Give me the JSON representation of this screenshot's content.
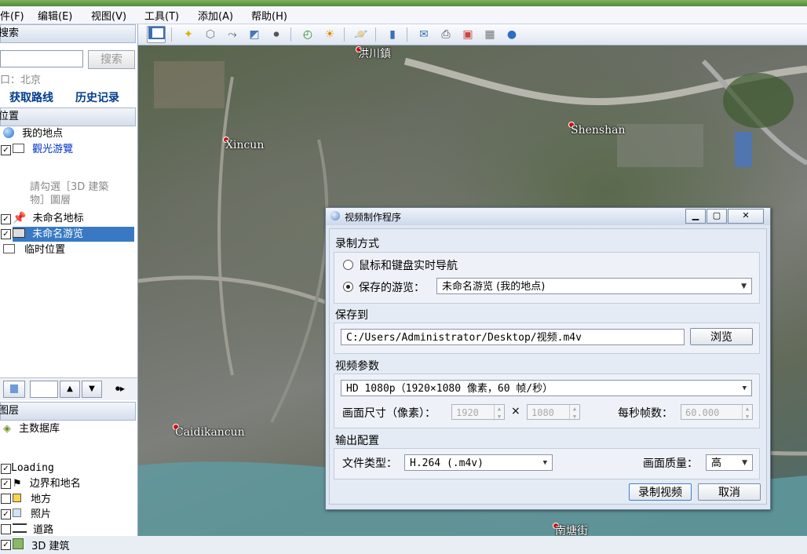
{
  "menu": [
    "件(F)",
    "编辑(E)",
    "视图(V)",
    "工具(T)",
    "添加(A)",
    "帮助(H)"
  ],
  "sidebar": {
    "search_head": "搜索",
    "search_button": "搜索",
    "search_hint": "口：北京",
    "get_route": "获取路线",
    "history": "历史记录",
    "places_head": "位置",
    "places": {
      "my_places": "我的地点",
      "sightseeing": "觀光游覽",
      "sightseeing_hint1": "請勾選［3D 建築",
      "sightseeing_hint2": "物］圖層",
      "unnamed_placemark": "未命名地标",
      "unnamed_tour": "未命名游览",
      "temp_places": "临时位置"
    },
    "layers_head": "图层",
    "layers": {
      "primary_db": "主数据库",
      "loading": "Loading",
      "borders": "边界和地名",
      "places": "地方",
      "photos": "照片",
      "roads": "道路",
      "buildings": "3D 建筑"
    }
  },
  "map": {
    "labels": {
      "hongchuan": "洪川鎮",
      "shenshan": "Shenshan",
      "xincun": "Xincun",
      "caidikancun": "Caidikancun",
      "nantangjie": "南塘街"
    }
  },
  "dialog": {
    "title": "视频制作程序",
    "record_mode": "录制方式",
    "radio_live": "鼠标和键盘实时导航",
    "radio_saved": "保存的游览：",
    "saved_tour_value": "未命名游览 (我的地点)",
    "save_to": "保存到",
    "path_value": "C:/Users/Administrator/Desktop/视频.m4v",
    "browse": "浏览",
    "video_params": "视频参数",
    "preset_value": "HD 1080p（1920×1080 像素，60 帧/秒）",
    "frame_size_label": "画面尺寸（像素）：",
    "width_value": "1920",
    "times": "×",
    "height_value": "1080",
    "fps_label": "每秒帧数：",
    "fps_value": "60.000",
    "output_config": "输出配置",
    "file_type_label": "文件类型：",
    "file_type_value": "H.264 (.m4v)",
    "quality_label": "画面质量：",
    "quality_value": "高",
    "record_button": "录制视频",
    "cancel_button": "取消"
  }
}
